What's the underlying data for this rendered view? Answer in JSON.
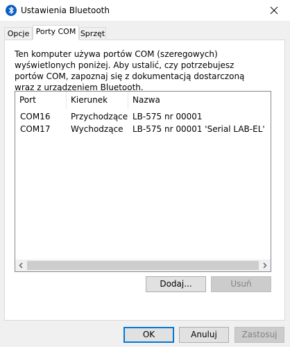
{
  "window": {
    "title": "Ustawienia Bluetooth",
    "title_icon": "bluetooth-icon",
    "close_icon": "close-icon"
  },
  "tabs": [
    {
      "label": "Opcje",
      "selected": false
    },
    {
      "label": "Porty COM",
      "selected": true
    },
    {
      "label": "Sprzęt",
      "selected": false
    }
  ],
  "page": {
    "description": "Ten komputer używa portów COM (szeregowych) wyświetlonych poniżej. Aby ustalić, czy potrzebujesz portów COM, zapoznaj się z dokumentacją dostarczoną wraz z urządzeniem Bluetooth."
  },
  "list": {
    "columns": [
      "Port",
      "Kierunek",
      "Nazwa"
    ],
    "rows": [
      {
        "port": "COM16",
        "direction": "Przychodzące",
        "name": "LB-575 nr 00001"
      },
      {
        "port": "COM17",
        "direction": "Wychodzące",
        "name": "LB-575 nr 00001 'Serial LAB-EL'"
      }
    ]
  },
  "buttons": {
    "add": "Dodaj...",
    "remove": "Usuń",
    "ok": "OK",
    "cancel": "Anuluj",
    "apply": "Zastosuj"
  },
  "colors": {
    "accent": "#0078d7",
    "bluetooth_icon": "#0a5fc7"
  }
}
